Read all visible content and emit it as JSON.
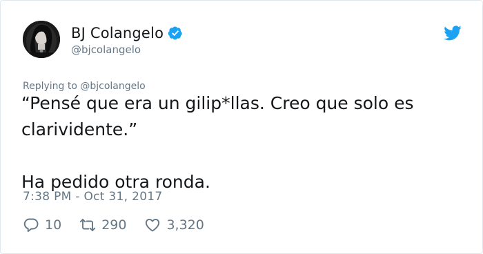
{
  "user": {
    "display_name": "BJ Colangelo",
    "handle": "@bjcolangelo",
    "verified": true
  },
  "tweet": {
    "reply_context": "Replying to @bjcolangelo",
    "text": "“Pensé que era un gilip*llas. Creo que solo es\nclarividente.”\n\nHa pedido otra ronda.",
    "timestamp": "7:38 PM - Oct 31, 2017"
  },
  "actions": {
    "replies": "10",
    "retweets": "290",
    "likes": "3,320"
  },
  "icons": {
    "verified": "verified-badge-icon",
    "brand": "twitter-bird-icon",
    "reply": "reply-icon",
    "retweet": "retweet-icon",
    "like": "heart-icon"
  },
  "colors": {
    "brand_blue": "#1da1f2",
    "text_primary": "#14171a",
    "text_secondary": "#657786",
    "border": "#e1e8ed"
  }
}
